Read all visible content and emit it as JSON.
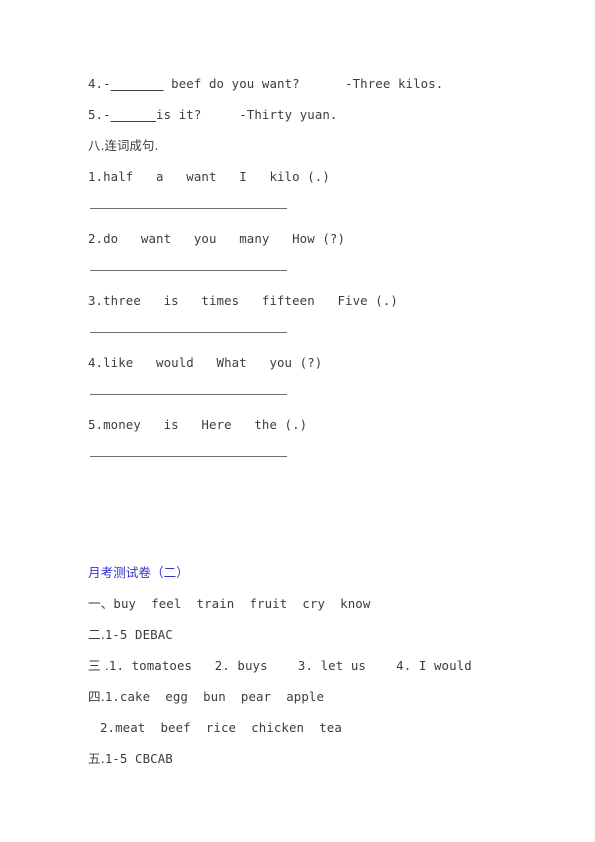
{
  "document": {
    "page_background": "#ffffff",
    "text_color": "#3d3d3d",
    "accent_color": "#3333cc",
    "rule_color": "#6f6f6f"
  },
  "fill_in_section": {
    "items": [
      {
        "number": "4.-",
        "blank": "_______",
        "question": " beef do you want?",
        "gap": "      ",
        "answer": "-Three kilos."
      },
      {
        "number": "5.-",
        "blank": "______",
        "question": "is it?",
        "gap": "     ",
        "answer": "-Thirty yuan."
      }
    ]
  },
  "reorder_section": {
    "heading": "八.连词成句.",
    "items": [
      {
        "label": "1.",
        "words": "half   a   want   I   kilo (.)"
      },
      {
        "label": "2.",
        "words": "do   want   you   many   How (?)"
      },
      {
        "label": "3.",
        "words": "three   is   times   fifteen   Five (.)"
      },
      {
        "label": "4.",
        "words": "like   would   What   you (?)"
      },
      {
        "label": "5.",
        "words": "money   is   Here   the (.)"
      }
    ],
    "answer_rule_label": "answer-line"
  },
  "answer_key": {
    "title": "月考测试卷（二）",
    "lines": [
      {
        "marker": "一、",
        "text": "buy  feel  train  fruit  cry  know",
        "indent": false
      },
      {
        "marker": "二.",
        "text": "1-5 DEBAC",
        "indent": false
      },
      {
        "marker": "三 .",
        "text": "1. tomatoes   2. buys    3. let us    4. I would",
        "indent": false
      },
      {
        "marker": "四.",
        "text": "1.cake  egg  bun  pear  apple",
        "indent": false
      },
      {
        "marker": "",
        "text": "2.meat  beef  rice  chicken  tea",
        "indent": true
      },
      {
        "marker": "五.",
        "text": "1-5 CBCAB",
        "indent": false
      }
    ]
  }
}
